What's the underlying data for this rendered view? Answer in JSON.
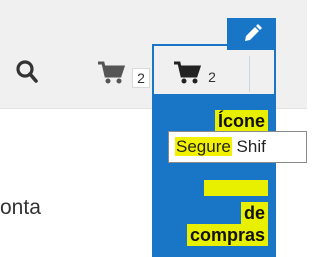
{
  "toolbar": {
    "search_icon": "search-icon",
    "cart_icon": "cart-icon",
    "edit_icon": "pencil-icon",
    "cart_count_primary": "2",
    "cart_count_secondary": "2"
  },
  "annotation": {
    "lines": [
      "Ícone",
      "de",
      "compras"
    ]
  },
  "tooltip": {
    "highlight": "Segure",
    "rest": " Shif"
  },
  "content": {
    "partial_text": "onta"
  },
  "colors": {
    "accent_blue": "#1976c7",
    "highlight_yellow": "#e8f000",
    "toolbar_bg": "#f0f0f0"
  }
}
